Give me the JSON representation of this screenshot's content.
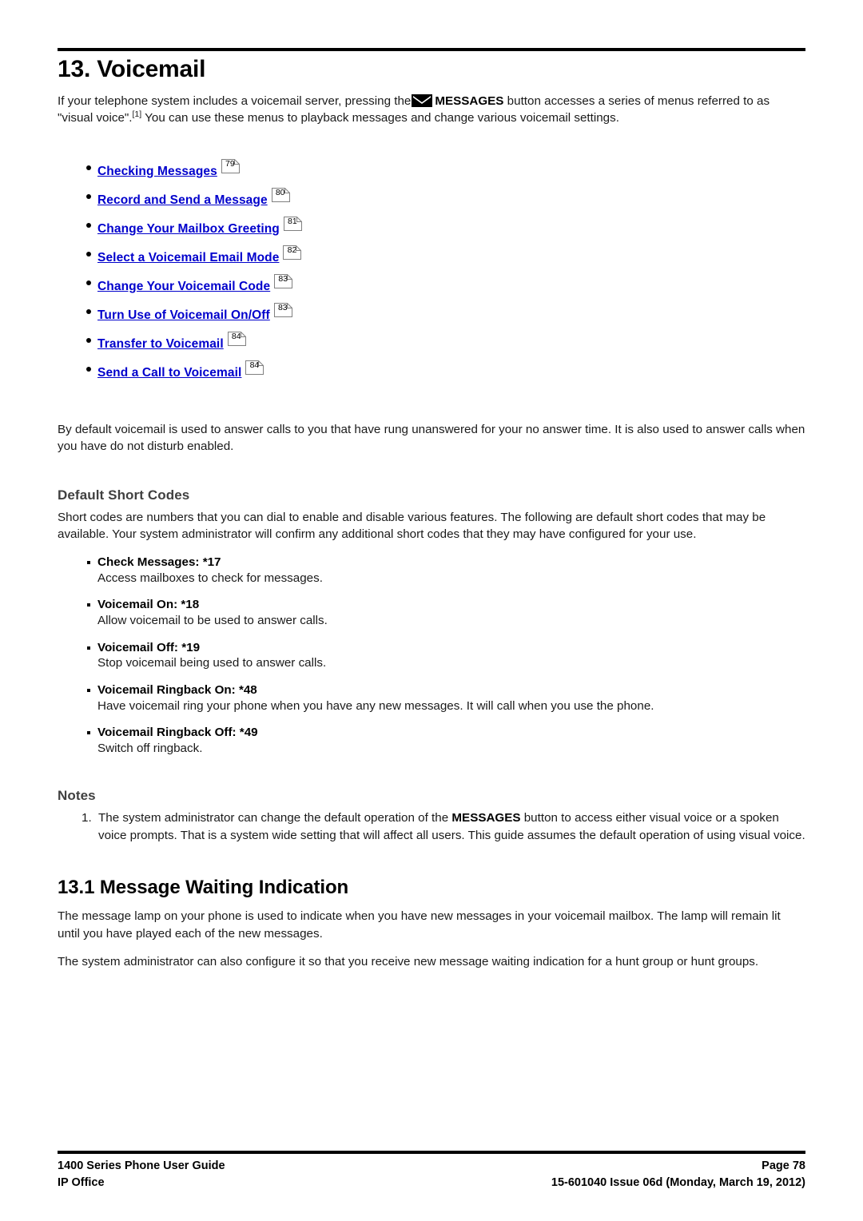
{
  "document": {
    "chapter_title": "13. Voicemail",
    "intro": {
      "before_icon": "If your telephone system includes a voicemail server, pressing the",
      "icon": "envelope-icon",
      "icon_label": "MESSAGES",
      "after_icon": "button accesses a series of menus referred to as \"visual voice\".",
      "footnote_marker": "[1]",
      "tail": "You can use these menus to playback messages and change various voicemail settings."
    },
    "toc": [
      {
        "label": "Checking Messages",
        "page": "79"
      },
      {
        "label": "Record and Send a Message",
        "page": "80"
      },
      {
        "label": "Change Your Mailbox Greeting",
        "page": "81"
      },
      {
        "label": "Select a Voicemail Email Mode",
        "page": "82"
      },
      {
        "label": "Change Your Voicemail Code",
        "page": "83"
      },
      {
        "label": "Turn Use of Voicemail On/Off",
        "page": "83"
      },
      {
        "label": "Transfer to Voicemail",
        "page": "84"
      },
      {
        "label": "Send a Call to Voicemail",
        "page": "84"
      }
    ],
    "default_para": "By default voicemail is used to answer calls to you that have rung unanswered for your no answer time. It is also used to answer calls when you have do not disturb enabled.",
    "short_codes": {
      "heading": "Default Short Codes",
      "intro": "Short codes are numbers that you can dial to enable and disable various features. The following are default short codes that may be available. Your system administrator will confirm any additional short codes that they may have configured for your use.",
      "items": [
        {
          "term": "Check Messages: *17",
          "desc": "Access mailboxes to check for messages."
        },
        {
          "term": "Voicemail On: *18",
          "desc": "Allow voicemail to be used to answer calls."
        },
        {
          "term": "Voicemail Off: *19",
          "desc": "Stop voicemail being used to answer calls."
        },
        {
          "term": "Voicemail Ringback On: *48",
          "desc": "Have voicemail ring your phone when you have any new messages. It will call when you use the phone."
        },
        {
          "term": "Voicemail Ringback Off: *49",
          "desc": "Switch off ringback."
        }
      ]
    },
    "notes": {
      "heading": "Notes",
      "items": [
        {
          "number": "1.",
          "part1": "The system administrator can change the default operation of the",
          "bold": "MESSAGES",
          "part2": "button to access either visual voice or a spoken voice prompts. That is a system wide setting that will affect all users. This guide assumes the default operation of using visual voice."
        }
      ]
    },
    "section_131": {
      "title": "13.1 Message Waiting Indication",
      "para1": "The message lamp on your phone is used to indicate when you have new messages in your voicemail mailbox. The lamp will remain lit until you have played each of the new messages.",
      "para2": "The system administrator can also configure it so that you receive new message waiting indication for a hunt group or hunt groups."
    }
  },
  "footer": {
    "left_line1": "1400 Series Phone User Guide",
    "left_line2": "IP Office",
    "right_line1": "Page 78",
    "right_line2": "15-601040 Issue 06d (Monday, March 19, 2012)"
  },
  "colors": {
    "link": "#0000CC",
    "heading_gray": "#404040",
    "body": "#1a1a1a",
    "rule": "#000000"
  }
}
